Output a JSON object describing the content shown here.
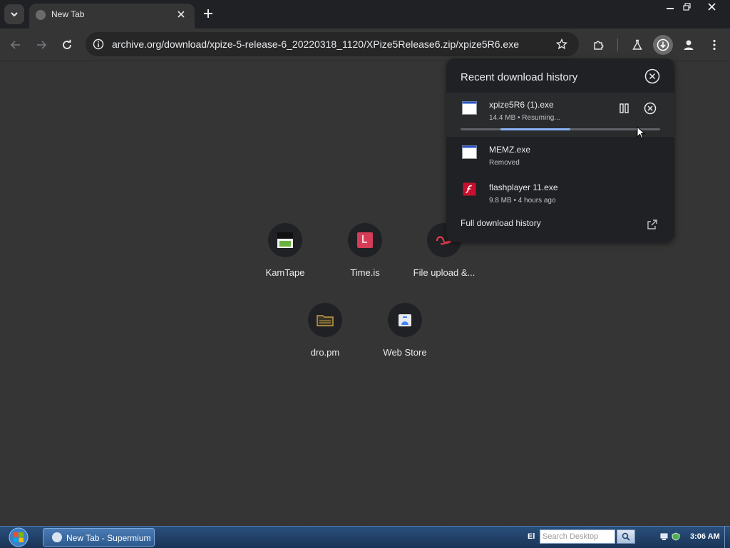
{
  "tabstrip": {
    "tab_title": "New Tab"
  },
  "toolbar": {
    "url": "archive.org/download/xpize-5-release-6_20220318_1120/XPize5Release6.zip/xpize5R6.exe"
  },
  "shortcuts": [
    {
      "label": "KamTape"
    },
    {
      "label": "Time.is"
    },
    {
      "label": "File upload &..."
    },
    {
      "label": "dro.pm"
    },
    {
      "label": "Web Store"
    }
  ],
  "downloads": {
    "title": "Recent download history",
    "items": [
      {
        "name": "xpize5R6 (1).exe",
        "status": "14.4 MB • Resuming...",
        "progress_start": 0.2,
        "progress_end": 0.55,
        "icon": "exe-window-icon"
      },
      {
        "name": "MEMZ.exe",
        "status": "Removed",
        "icon": "exe-window-icon"
      },
      {
        "name": "flashplayer 11.exe",
        "status": "9.8 MB • 4 hours ago",
        "icon": "flash-icon"
      }
    ],
    "full_history": "Full download history"
  },
  "taskbar": {
    "task_label": "New Tab - Supermium",
    "lang": "El",
    "search_placeholder": "Search Desktop",
    "clock": "3:06 AM"
  },
  "colors": {
    "accent": "#8ab4f8",
    "page_bg": "#353535",
    "popup_bg": "#202124"
  }
}
